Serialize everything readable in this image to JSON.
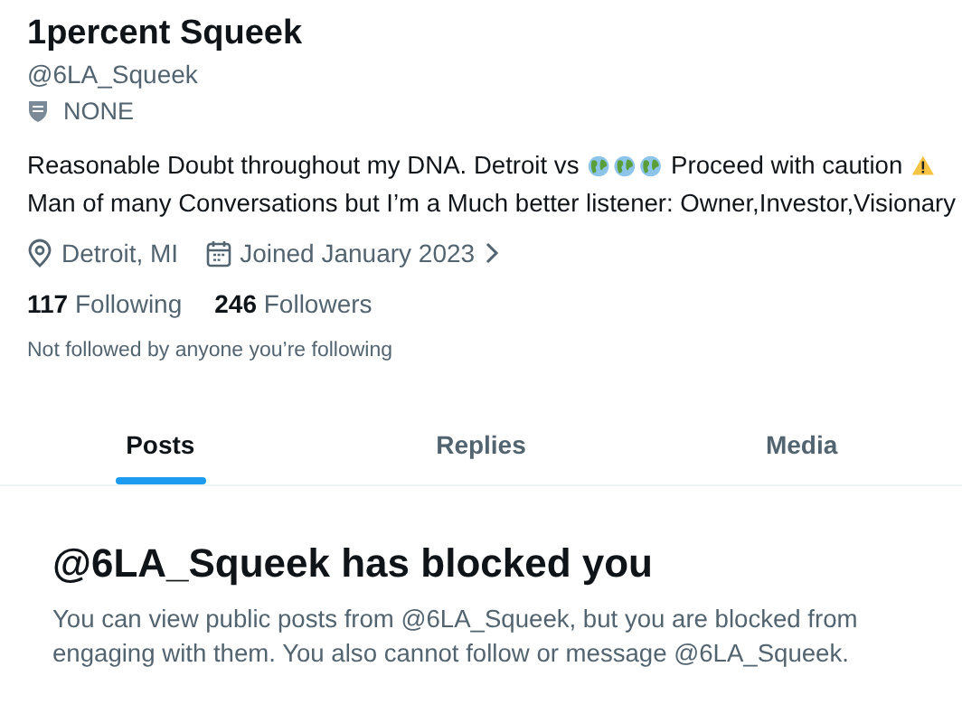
{
  "profile": {
    "name": "1percent Squeek",
    "handle": "@6LA_Squeek",
    "label": "NONE",
    "bio": [
      {
        "kind": "text",
        "text": "Reasonable Doubt throughout my DNA. Detroit vs"
      },
      {
        "kind": "globes"
      },
      {
        "kind": "text",
        "text": "Proceed with caution"
      },
      {
        "kind": "warning"
      },
      {
        "kind": "break"
      },
      {
        "kind": "text",
        "text": "Man of many Conversations but I’m a Much better listener: Owner,Investor,Visionary"
      }
    ],
    "location": "Detroit, MI",
    "joined": "Joined January 2023",
    "stats": [
      {
        "count": "117",
        "label": "Following"
      },
      {
        "count": "246",
        "label": "Followers"
      }
    ],
    "followed_note": "Not followed by anyone you’re following"
  },
  "tabs": [
    {
      "label": "Posts",
      "selected": true
    },
    {
      "label": "Replies",
      "selected": false
    },
    {
      "label": "Media",
      "selected": false
    }
  ],
  "blocked": {
    "title": "@6LA_Squeek has blocked you",
    "message": "You can view public posts from @6LA_Squeek, but you are blocked from engaging with them. You also cannot follow or message @6LA_Squeek."
  }
}
